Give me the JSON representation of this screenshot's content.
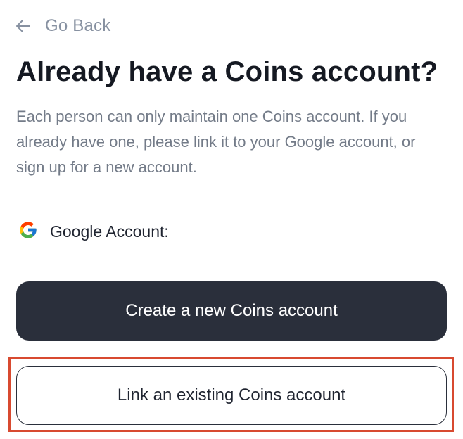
{
  "nav": {
    "back_label": "Go Back",
    "back_icon": "arrow-left-icon"
  },
  "heading": {
    "title": "Already have a Coins account?",
    "description": "Each person can only maintain one Coins account. If you already have one, please link it to your Google account, or sign up for a new account."
  },
  "google_account": {
    "icon": "google-icon",
    "label": "Google Account:"
  },
  "actions": {
    "create_label": "Create a new Coins account",
    "link_label": "Link an existing Coins account"
  },
  "colors": {
    "primary_button": "#2a2f3b",
    "muted_text": "#8791a1",
    "highlight": "#d84a30"
  }
}
